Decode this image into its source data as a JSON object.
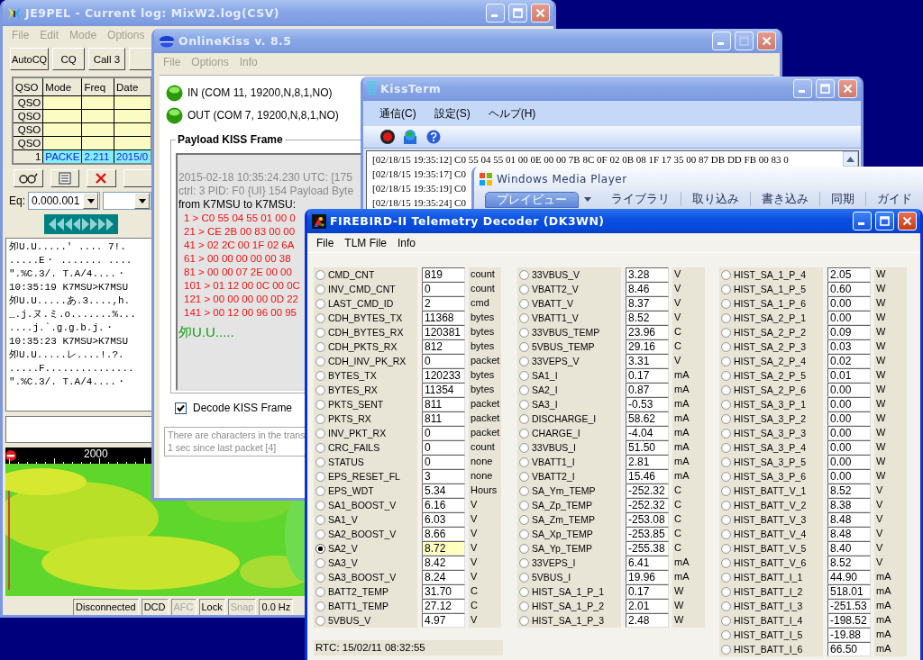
{
  "log_window": {
    "title": "JE9PEL - Current log: MixW2.log(CSV)",
    "active": false,
    "menu": [
      "File",
      "Edit",
      "Mode",
      "Options"
    ],
    "toolbar": [
      "AutoCQ",
      "CQ",
      "Call 3"
    ],
    "grid": {
      "columns": [
        "QSO",
        "Mode",
        "Freq",
        "Date"
      ],
      "rows": [
        {
          "kind": "empty",
          "label": "QSO"
        },
        {
          "kind": "empty",
          "label": "QSO"
        },
        {
          "kind": "empty",
          "label": "QSO"
        },
        {
          "kind": "empty",
          "label": "QSO"
        },
        {
          "kind": "entry",
          "label": "1",
          "cells": [
            "PACKE",
            "2.211",
            "2015/0"
          ]
        }
      ]
    },
    "freq_field": {
      "label": "Eq:",
      "value": "0.000.001"
    },
    "receive_text": [
      "夘U.U.....′ .... 7!.",
      ".....E・ ....... ....",
      "″.%C.3/. T.A/4....・",
      "10:35:19 K7MSU>K7MSU",
      "夘U.U.....あ.3....,h.",
      "_.j.ヌ.ミ.o.......%...",
      "....j.`.g.g.b.j.・",
      "10:35:23 K7MSU>K7MSU",
      "夘U.U.....レ....!.?.",
      ".....F...............",
      "″.%C.3/. T.A/4....・"
    ],
    "ruler_label": "2000",
    "status_bar": [
      {
        "text": "Disconnected",
        "disabled": false
      },
      {
        "text": "DCD",
        "disabled": false
      },
      {
        "text": "AFC",
        "disabled": true
      },
      {
        "text": "Lock",
        "disabled": false
      },
      {
        "text": "Snap",
        "disabled": true
      },
      {
        "text": "0.0 Hz",
        "disabled": false
      }
    ]
  },
  "kiss_window": {
    "title": "OnlineKiss v. 8.5",
    "active": false,
    "maximize_disabled": true,
    "menu": [
      "File",
      "Options",
      "Info"
    ],
    "ports": [
      {
        "label": "IN (COM 11, 19200,N,8,1,NO)",
        "on": true
      },
      {
        "label": "OUT (COM 7, 19200,N,8,1,NO)",
        "on": true
      }
    ],
    "payload": {
      "title": "Payload KISS Frame",
      "header_lines": [
        "2015-02-18 10:35:24.230 UTC: [175",
        "ctrl: 3   PID: F0 {UI}   154 Payload Byte"
      ],
      "from_line": "from K7MSU to K7MSU:",
      "hex_lines": [
        "1 > C0 55 04 55 01 00 0",
        "21 > CE 2B 00 83 00 00",
        "41 > 02 2C 00 1F 02 6A",
        "61 > 00 00 00 00 00 38",
        "81 > 00 00 07 2E 00 00",
        "101 > 01 12 00 0C 00 0C",
        "121 > 00 00 00 00 0D 22",
        "141 > 00 12 00 96 00 95"
      ],
      "decoded_line": "夘U.U....."
    },
    "decode_checkbox": {
      "label": "Decode KISS Frame",
      "checked": true
    },
    "status_lines": [
      "There are characters in the trans",
      "1 sec since last packet [4]"
    ]
  },
  "kissterm_window": {
    "title": "KissTerm",
    "logo": "KISS",
    "active": false,
    "menu": [
      "通信(C)",
      "設定(S)",
      "ヘルプ(H)"
    ],
    "lines": [
      "[02/18/15 19:35:12] C0 55 04 55 01 00 0E 00 00 7B 8C 0F 02 0B 08 1F 17 35 00 87 DB DD FB 00 83 0",
      "[02/18/15 19:35:17] C0",
      "[02/18/15 19:35:19] C0",
      "[02/18/15 19:35:24] C0"
    ]
  },
  "media_player_window": {
    "title": "Windows Media Player",
    "active": false,
    "tabs": [
      {
        "label": "プレイビュー",
        "selected": true
      },
      {
        "label": "ライブラリ",
        "selected": false
      },
      {
        "label": "取り込み",
        "selected": false
      },
      {
        "label": "書き込み",
        "selected": false
      },
      {
        "label": "同期",
        "selected": false
      },
      {
        "label": "ガイド",
        "selected": false
      }
    ]
  },
  "telemetry_window": {
    "title": "FIREBIRD-II Telemetry Decoder (DK3WN)",
    "active": true,
    "menu": [
      "File",
      "TLM File",
      "Info"
    ],
    "columns": [
      {
        "rows": [
          {
            "name": "CMD_CNT",
            "value": "819",
            "unit": "count",
            "selected": false
          },
          {
            "name": "INV_CMD_CNT",
            "value": "0",
            "unit": "count",
            "selected": false
          },
          {
            "name": "LAST_CMD_ID",
            "value": "2",
            "unit": "cmd",
            "selected": false
          },
          {
            "name": "CDH_BYTES_TX",
            "value": "11368",
            "unit": "bytes",
            "selected": false
          },
          {
            "name": "CDH_BYTES_RX",
            "value": "120381",
            "unit": "bytes",
            "selected": false
          },
          {
            "name": "CDH_PKTS_RX",
            "value": "812",
            "unit": "bytes",
            "selected": false
          },
          {
            "name": "CDH_INV_PK_RX",
            "value": "0",
            "unit": "packet",
            "selected": false
          },
          {
            "name": "BYTES_TX",
            "value": "120233",
            "unit": "bytes",
            "selected": false
          },
          {
            "name": "BYTES_RX",
            "value": "11354",
            "unit": "bytes",
            "selected": false
          },
          {
            "name": "PKTS_SENT",
            "value": "811",
            "unit": "packet",
            "selected": false
          },
          {
            "name": "PKTS_RX",
            "value": "811",
            "unit": "packet",
            "selected": false
          },
          {
            "name": "INV_PKT_RX",
            "value": "0",
            "unit": "packet",
            "selected": false
          },
          {
            "name": "CRC_FAILS",
            "value": "0",
            "unit": "count",
            "selected": false
          },
          {
            "name": "STATUS",
            "value": "0",
            "unit": "none",
            "selected": false
          },
          {
            "name": "EPS_RESET_FL",
            "value": "3",
            "unit": "none",
            "selected": false
          },
          {
            "name": "EPS_WDT",
            "value": "5.34",
            "unit": "Hours",
            "selected": false
          },
          {
            "name": "SA1_BOOST_V",
            "value": "6.16",
            "unit": "V",
            "selected": false
          },
          {
            "name": "SA1_V",
            "value": "6.03",
            "unit": "V",
            "selected": false
          },
          {
            "name": "SA2_BOOST_V",
            "value": "8.66",
            "unit": "V",
            "selected": false
          },
          {
            "name": "SA2_V",
            "value": "8.72",
            "unit": "V",
            "selected": true
          },
          {
            "name": "SA3_V",
            "value": "8.42",
            "unit": "V",
            "selected": false
          },
          {
            "name": "SA3_BOOST_V",
            "value": "8.24",
            "unit": "V",
            "selected": false
          },
          {
            "name": "BATT2_TEMP",
            "value": "31.70",
            "unit": "C",
            "selected": false
          },
          {
            "name": "BATT1_TEMP",
            "value": "27.12",
            "unit": "C",
            "selected": false
          },
          {
            "name": "5VBUS_V",
            "value": "4.97",
            "unit": "V",
            "selected": false
          }
        ]
      },
      {
        "rows": [
          {
            "name": "33VBUS_V",
            "value": "3.28",
            "unit": "V",
            "selected": false
          },
          {
            "name": "VBATT2_V",
            "value": "8.46",
            "unit": "V",
            "selected": false
          },
          {
            "name": "VBATT_V",
            "value": "8.37",
            "unit": "V",
            "selected": false
          },
          {
            "name": "VBATT1_V",
            "value": "8.52",
            "unit": "V",
            "selected": false
          },
          {
            "name": "33VBUS_TEMP",
            "value": "23.96",
            "unit": "C",
            "selected": false
          },
          {
            "name": "5VBUS_TEMP",
            "value": "29.16",
            "unit": "C",
            "selected": false
          },
          {
            "name": "33VEPS_V",
            "value": "3.31",
            "unit": "V",
            "selected": false
          },
          {
            "name": "SA1_I",
            "value": "0.17",
            "unit": "mA",
            "selected": false
          },
          {
            "name": "SA2_I",
            "value": "0.87",
            "unit": "mA",
            "selected": false
          },
          {
            "name": "SA3_I",
            "value": "-0.53",
            "unit": "mA",
            "selected": false
          },
          {
            "name": "DISCHARGE_I",
            "value": "58.62",
            "unit": "mA",
            "selected": false
          },
          {
            "name": "CHARGE_I",
            "value": "-4.04",
            "unit": "mA",
            "selected": false
          },
          {
            "name": "33VBUS_I",
            "value": "51.50",
            "unit": "mA",
            "selected": false
          },
          {
            "name": "VBATT1_I",
            "value": "2.81",
            "unit": "mA",
            "selected": false
          },
          {
            "name": "VBATT2_I",
            "value": "15.46",
            "unit": "mA",
            "selected": false
          },
          {
            "name": "SA_Ym_TEMP",
            "value": "-252.32",
            "unit": "C",
            "selected": false
          },
          {
            "name": "SA_Zp_TEMP",
            "value": "-252.32",
            "unit": "C",
            "selected": false
          },
          {
            "name": "SA_Zm_TEMP",
            "value": "-253.08",
            "unit": "C",
            "selected": false
          },
          {
            "name": "SA_Xp_TEMP",
            "value": "-253.85",
            "unit": "C",
            "selected": false
          },
          {
            "name": "SA_Yp_TEMP",
            "value": "-255.38",
            "unit": "C",
            "selected": false
          },
          {
            "name": "33VEPS_I",
            "value": "6.41",
            "unit": "mA",
            "selected": false
          },
          {
            "name": "5VBUS_I",
            "value": "19.96",
            "unit": "mA",
            "selected": false
          },
          {
            "name": "HIST_SA_1_P_1",
            "value": "0.17",
            "unit": "W",
            "selected": false
          },
          {
            "name": "HIST_SA_1_P_2",
            "value": "2.01",
            "unit": "W",
            "selected": false
          },
          {
            "name": "HIST_SA_1_P_3",
            "value": "2.48",
            "unit": "W",
            "selected": false
          }
        ]
      },
      {
        "rows": [
          {
            "name": "HIST_SA_1_P_4",
            "value": "2.05",
            "unit": "W",
            "selected": false
          },
          {
            "name": "HIST_SA_1_P_5",
            "value": "0.60",
            "unit": "W",
            "selected": false
          },
          {
            "name": "HIST_SA_1_P_6",
            "value": "0.00",
            "unit": "W",
            "selected": false
          },
          {
            "name": "HIST_SA_2_P_1",
            "value": "0.00",
            "unit": "W",
            "selected": false
          },
          {
            "name": "HIST_SA_2_P_2",
            "value": "0.09",
            "unit": "W",
            "selected": false
          },
          {
            "name": "HIST_SA_2_P_3",
            "value": "0.03",
            "unit": "W",
            "selected": false
          },
          {
            "name": "HIST_SA_2_P_4",
            "value": "0.02",
            "unit": "W",
            "selected": false
          },
          {
            "name": "HIST_SA_2_P_5",
            "value": "0.01",
            "unit": "W",
            "selected": false
          },
          {
            "name": "HIST_SA_2_P_6",
            "value": "0.00",
            "unit": "W",
            "selected": false
          },
          {
            "name": "HIST_SA_3_P_1",
            "value": "0.00",
            "unit": "W",
            "selected": false
          },
          {
            "name": "HIST_SA_3_P_2",
            "value": "0.00",
            "unit": "W",
            "selected": false
          },
          {
            "name": "HIST_SA_3_P_3",
            "value": "0.00",
            "unit": "W",
            "selected": false
          },
          {
            "name": "HIST_SA_3_P_4",
            "value": "0.00",
            "unit": "W",
            "selected": false
          },
          {
            "name": "HIST_SA_3_P_5",
            "value": "0.00",
            "unit": "W",
            "selected": false
          },
          {
            "name": "HIST_SA_3_P_6",
            "value": "0.00",
            "unit": "W",
            "selected": false
          },
          {
            "name": "HIST_BATT_V_1",
            "value": "8.52",
            "unit": "V",
            "selected": false
          },
          {
            "name": "HIST_BATT_V_2",
            "value": "8.38",
            "unit": "V",
            "selected": false
          },
          {
            "name": "HIST_BATT_V_3",
            "value": "8.48",
            "unit": "V",
            "selected": false
          },
          {
            "name": "HIST_BATT_V_4",
            "value": "8.48",
            "unit": "V",
            "selected": false
          },
          {
            "name": "HIST_BATT_V_5",
            "value": "8.40",
            "unit": "V",
            "selected": false
          },
          {
            "name": "HIST_BATT_V_6",
            "value": "8.52",
            "unit": "V",
            "selected": false
          },
          {
            "name": "HIST_BATT_I_1",
            "value": "44.90",
            "unit": "mA",
            "selected": false
          },
          {
            "name": "HIST_BATT_I_2",
            "value": "518.01",
            "unit": "mA",
            "selected": false
          },
          {
            "name": "HIST_BATT_I_3",
            "value": "-251.53",
            "unit": "mA",
            "selected": false
          },
          {
            "name": "HIST_BATT_I_4",
            "value": "-198.52",
            "unit": "mA",
            "selected": false
          },
          {
            "name": "HIST_BATT_I_5",
            "value": "-19.88",
            "unit": "mA",
            "selected": false
          },
          {
            "name": "HIST_BATT_I_6",
            "value": "66.50",
            "unit": "mA",
            "selected": false
          }
        ]
      }
    ],
    "rtc": "RTC: 15/02/11 08:32:55"
  }
}
